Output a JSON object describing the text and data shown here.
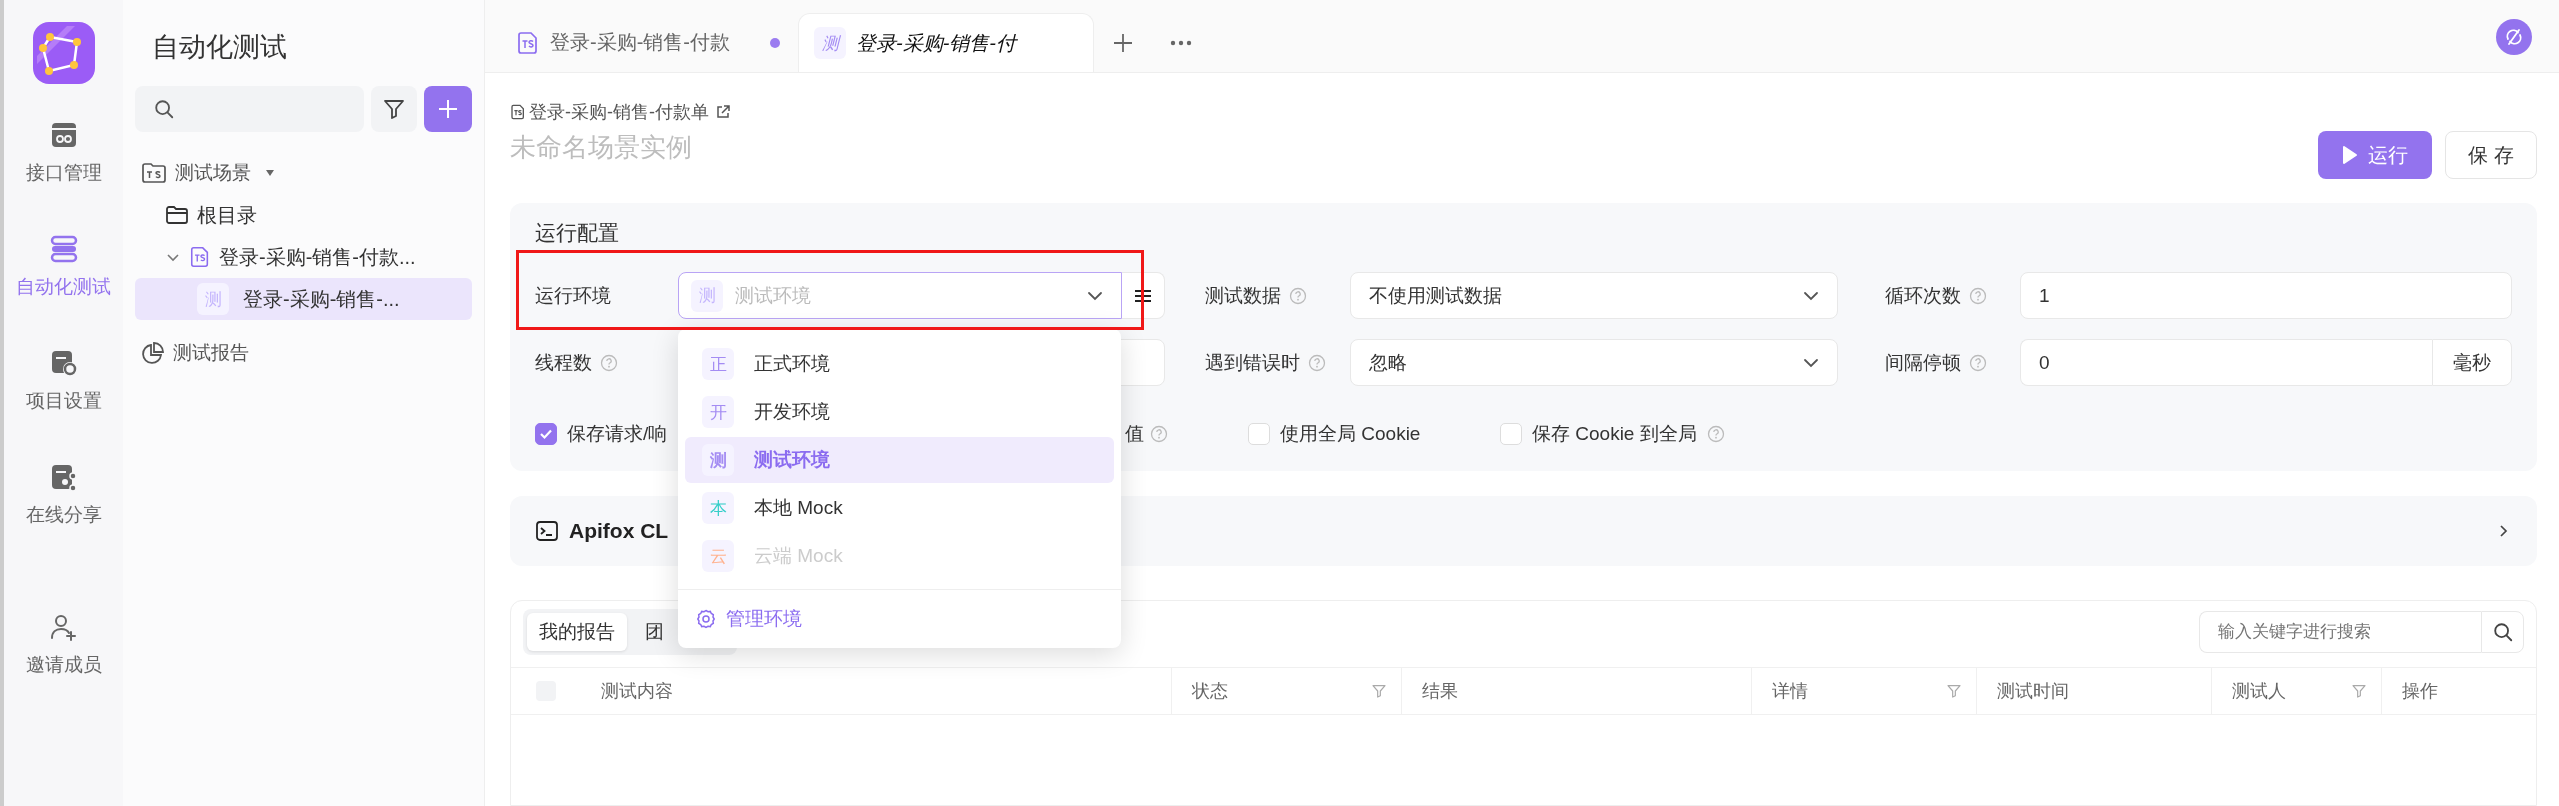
{
  "rail": {
    "items": [
      {
        "label": "接口管理",
        "selected": false
      },
      {
        "label": "自动化测试",
        "selected": true
      },
      {
        "label": "项目设置",
        "selected": false
      },
      {
        "label": "在线分享",
        "selected": false
      },
      {
        "label": "邀请成员",
        "selected": false
      }
    ]
  },
  "tree_panel": {
    "title": "自动化测试",
    "tree": [
      {
        "kind": "section",
        "label": "测试场景",
        "selected": false,
        "children": [
          {
            "kind": "folder",
            "label": "根目录",
            "selected": false
          },
          {
            "kind": "scenario",
            "label": "登录-采购-销售-付款...",
            "selected": false,
            "expanded": true,
            "children": [
              {
                "kind": "case",
                "badge": "测",
                "label": "登录-采购-销售-...",
                "selected": true
              }
            ]
          }
        ]
      },
      {
        "kind": "report",
        "label": "测试报告",
        "selected": false
      }
    ]
  },
  "tabs": [
    {
      "kind": "scenario",
      "label": "登录-采购-销售-付款",
      "unsaved": true,
      "selected": false
    },
    {
      "kind": "case",
      "badge": "测",
      "label": "登录-采购-销售-付",
      "unsaved": false,
      "selected": true
    }
  ],
  "editor": {
    "breadcrumb": "登录-采购-销售-付款单",
    "name_field": {
      "placeholder": "未命名场景实例"
    },
    "buttons": [
      {
        "kind": "primary",
        "label": "运行"
      },
      {
        "kind": "default",
        "label": "保 存"
      }
    ],
    "config": {
      "title": "运行配置",
      "fields": [
        {
          "kind": "select",
          "label": "运行环境",
          "help": false,
          "badge": "测",
          "value": "测试环境",
          "open": true,
          "list_button": true,
          "dropdown": {
            "options": [
              {
                "badge": "正",
                "label": "正式环境",
                "color": "#a48cf3",
                "selected": false,
                "disabled": false
              },
              {
                "badge": "开",
                "label": "开发环境",
                "color": "#a48cf3",
                "selected": false,
                "disabled": false
              },
              {
                "badge": "测",
                "label": "测试环境",
                "color": "#a48cf3",
                "selected": true,
                "disabled": false
              },
              {
                "badge": "本",
                "label": "本地 Mock",
                "color": "#36cfc9",
                "selected": false,
                "disabled": false
              },
              {
                "badge": "云",
                "label": "云端 Mock",
                "color": "#ffb28f",
                "selected": false,
                "disabled": true
              }
            ],
            "footer": "管理环境"
          }
        },
        {
          "kind": "select",
          "label": "测试数据",
          "help": true,
          "value": "不使用测试数据",
          "open": false
        },
        {
          "kind": "input",
          "label": "循环次数",
          "help": true,
          "value": "1"
        },
        {
          "kind": "input",
          "label": "线程数",
          "help": true
        },
        {
          "kind": "select",
          "label": "遇到错误时",
          "help": true,
          "value": "忽略",
          "open": false
        },
        {
          "kind": "input",
          "label": "间隔停顿",
          "help": true,
          "value": "0",
          "unit": "毫秒"
        }
      ],
      "options": [
        {
          "kind": "checkbox",
          "label": "保存请求/响",
          "checked": true,
          "help": false
        },
        {
          "kind": "tail",
          "label": "值",
          "help": true
        },
        {
          "kind": "checkbox",
          "label": "使用全局 Cookie",
          "checked": false,
          "help": false
        },
        {
          "kind": "checkbox",
          "label": "保存 Cookie 到全局",
          "checked": false,
          "help": true
        }
      ]
    },
    "cli": {
      "title": "Apifox CL"
    },
    "reports": {
      "tabs": [
        {
          "label": "我的报告",
          "selected": true
        },
        {
          "label": "团",
          "selected": false
        }
      ],
      "search": {
        "placeholder": "输入关键字进行搜索"
      },
      "header_checkbox": {
        "checked": false
      },
      "columns": [
        {
          "label": "测试内容",
          "filter": false
        },
        {
          "label": "状态",
          "filter": true
        },
        {
          "label": "结果",
          "filter": false
        },
        {
          "label": "详情",
          "filter": true
        },
        {
          "label": "测试时间",
          "filter": false
        },
        {
          "label": "测试人",
          "filter": true
        },
        {
          "label": "操作",
          "filter": false
        }
      ]
    }
  }
}
